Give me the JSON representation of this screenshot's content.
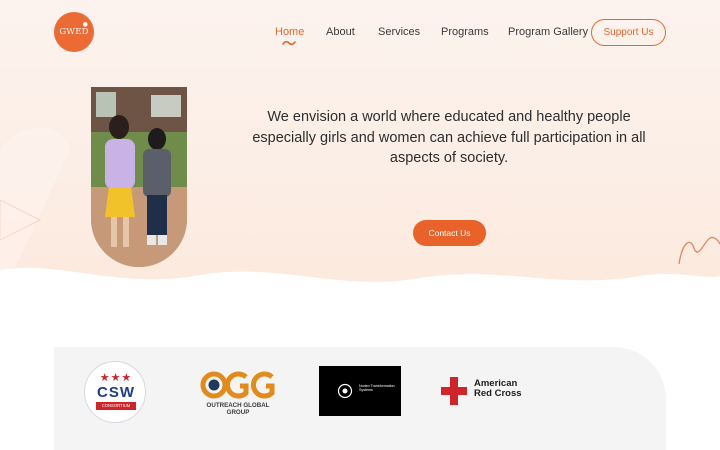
{
  "header": {
    "logo_text": "GWED",
    "nav": [
      {
        "label": "Home",
        "active": true
      },
      {
        "label": "About",
        "active": false
      },
      {
        "label": "Services",
        "active": false
      },
      {
        "label": "Programs",
        "active": false
      },
      {
        "label": "Program Gallery",
        "active": false
      }
    ],
    "support_label": "Support Us"
  },
  "hero": {
    "vision_text": "We envision a world where educated and healthy people especially girls and women can achieve full participation in all aspects of society.",
    "contact_label": "Contact Us",
    "photo_icon": "children-walking-photo"
  },
  "partners": {
    "csw": {
      "letters": "CSW",
      "band": "CONSORTIUM"
    },
    "ogg": {
      "mark": "OGG",
      "sub": "OUTREACH GLOBAL GROUP"
    },
    "ndt": {
      "text": "Noden Transformation Systems"
    },
    "arc": {
      "name": "American\nRed Cross"
    }
  },
  "colors": {
    "accent": "#e8622a",
    "hero_bg": "#fdf0e8",
    "partners_bg": "#f4f4f4"
  }
}
